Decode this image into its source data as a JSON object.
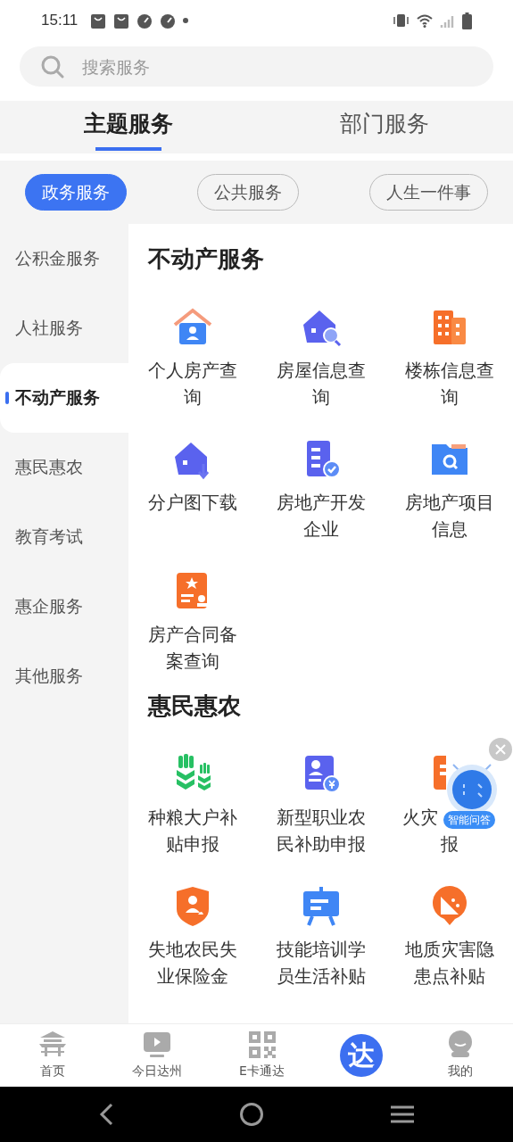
{
  "status_bar": {
    "time": "15:11"
  },
  "search": {
    "placeholder": "搜索服务"
  },
  "tabs": [
    {
      "label": "主题服务",
      "selected": true
    },
    {
      "label": "部门服务",
      "selected": false
    }
  ],
  "chips": [
    {
      "label": "政务服务",
      "selected": true
    },
    {
      "label": "公共服务",
      "selected": false
    },
    {
      "label": "人生一件事",
      "selected": false
    }
  ],
  "sidebar": {
    "items": [
      {
        "label": "公积金服务",
        "selected": false
      },
      {
        "label": "人社服务",
        "selected": false
      },
      {
        "label": "不动产服务",
        "selected": true
      },
      {
        "label": "惠民惠农",
        "selected": false
      },
      {
        "label": "教育考试",
        "selected": false
      },
      {
        "label": "惠企服务",
        "selected": false
      },
      {
        "label": "其他服务",
        "selected": false
      }
    ]
  },
  "sections": [
    {
      "title": "不动产服务",
      "items": [
        {
          "label": "个人房产查询"
        },
        {
          "label": "房屋信息查询"
        },
        {
          "label": "楼栋信息查询"
        },
        {
          "label": "分户图下载"
        },
        {
          "label": "房地产开发企业"
        },
        {
          "label": "房地产项目信息"
        },
        {
          "label": "房产合同备案查询"
        }
      ]
    },
    {
      "title": "惠民惠农",
      "items": [
        {
          "label": "种粮大户补贴申报"
        },
        {
          "label": "新型职业农民补助申报"
        },
        {
          "lines": [
            "火灾",
            "报"
          ]
        },
        {
          "label": "失地农民失业保险金"
        },
        {
          "label": "技能培训学员生活补贴"
        },
        {
          "label": "地质灾害隐患点补贴"
        }
      ]
    }
  ],
  "assistant": {
    "badge": "智能问答"
  },
  "bottom_nav": [
    {
      "label": "首页",
      "kind": "tab"
    },
    {
      "label": "今日达州",
      "kind": "tab"
    },
    {
      "label": "E卡通达",
      "kind": "tab"
    },
    {
      "label": "达",
      "kind": "center"
    },
    {
      "label": "我的",
      "kind": "tab"
    }
  ]
}
